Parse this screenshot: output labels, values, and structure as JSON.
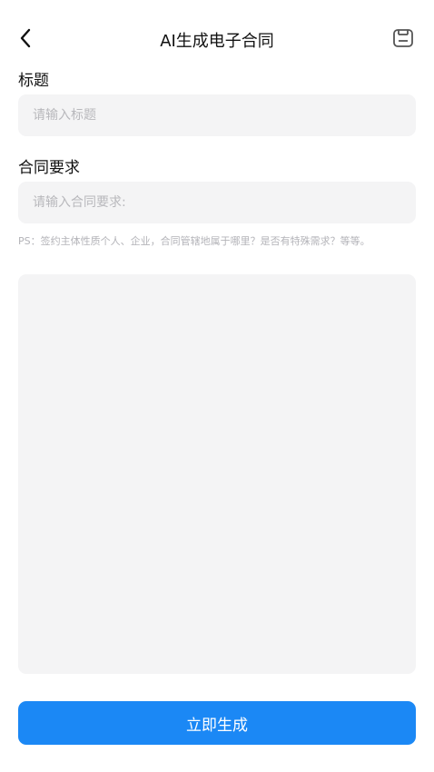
{
  "header": {
    "title": "AI生成电子合同",
    "back_icon": "chevron-left-icon",
    "save_icon": "save-icon"
  },
  "title_section": {
    "label": "标题",
    "placeholder": "请输入标题",
    "value": ""
  },
  "requirement_section": {
    "label": "合同要求",
    "placeholder": "请输入合同要求:",
    "value": "",
    "hint": "PS：签约主体性质个人、企业，合同管辖地属于哪里？是否有特殊需求？等等。"
  },
  "content_area": {
    "value": ""
  },
  "actions": {
    "generate_label": "立即生成"
  },
  "colors": {
    "accent": "#1b88f5",
    "field_bg": "#f4f4f5",
    "hint_text": "#b3b3b8"
  }
}
